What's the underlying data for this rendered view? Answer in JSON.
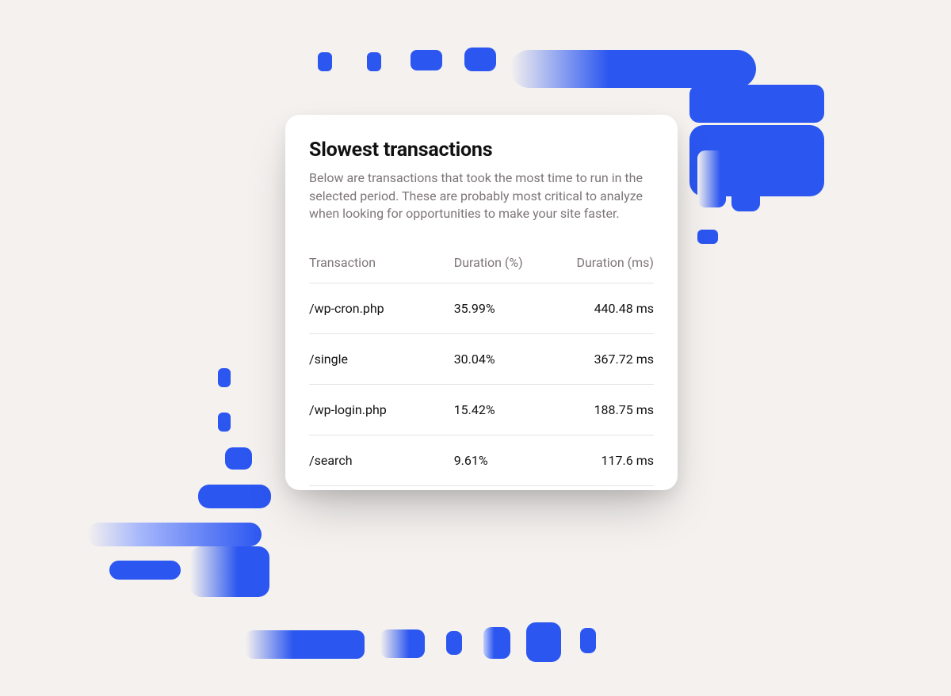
{
  "card": {
    "title": "Slowest transactions",
    "description": "Below are transactions that took the most time to run in the selected period. These are probably most critical to analyze when looking for opportunities to make your site faster."
  },
  "table": {
    "columns": {
      "transaction": "Transaction",
      "duration_pct": "Duration (%)",
      "duration_ms": "Duration (ms)"
    },
    "rows": [
      {
        "transaction": "/wp-cron.php",
        "duration_pct": "35.99%",
        "duration_ms": "440.48 ms"
      },
      {
        "transaction": "/single",
        "duration_pct": "30.04%",
        "duration_ms": "367.72 ms"
      },
      {
        "transaction": "/wp-login.php",
        "duration_pct": "15.42%",
        "duration_ms": "188.75 ms"
      },
      {
        "transaction": "/search",
        "duration_pct": "9.61%",
        "duration_ms": "117.6 ms"
      }
    ]
  }
}
